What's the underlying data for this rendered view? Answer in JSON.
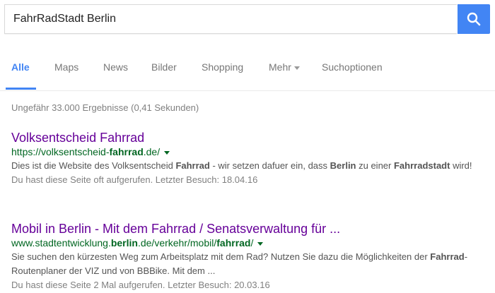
{
  "search": {
    "query": "FahrRadStadt Berlin"
  },
  "tabs": [
    {
      "label": "Alle"
    },
    {
      "label": "Maps"
    },
    {
      "label": "News"
    },
    {
      "label": "Bilder"
    },
    {
      "label": "Shopping"
    },
    {
      "label": "Mehr"
    },
    {
      "label": "Suchoptionen"
    }
  ],
  "stats": "Ungefähr 33.000 Ergebnisse (0,41 Sekunden)",
  "results": [
    {
      "title": "Volksentscheid Fahrrad",
      "url_pre": "https://volksentscheid-",
      "url_bold": "fahrrad",
      "url_post": ".de/",
      "snippet": [
        {
          "t": "Dies ist die Website des Volksentscheid ",
          "b": false
        },
        {
          "t": "Fahrrad",
          "b": true
        },
        {
          "t": " - wir setzen dafuer ein, dass ",
          "b": false
        },
        {
          "t": "Berlin",
          "b": true
        },
        {
          "t": " zu einer ",
          "b": false
        },
        {
          "t": "Fahrradstadt",
          "b": true
        },
        {
          "t": " wird!",
          "b": false
        }
      ],
      "visited": "Du hast diese Seite oft aufgerufen. Letzter Besuch: 18.04.16"
    },
    {
      "title": "Mobil in Berlin - Mit dem Fahrrad / Senatsverwaltung für ...",
      "url_pre": "www.stadtentwicklung.",
      "url_bold": "berlin",
      "url_mid": ".de/verkehr/mobil/",
      "url_bold2": "fahrrad",
      "url_post": "/",
      "snippet": [
        {
          "t": "Sie suchen den kürzesten Weg zum Arbeitsplatz mit dem Rad? Nutzen Sie dazu die Möglichkeiten der ",
          "b": false
        },
        {
          "t": "Fahrrad",
          "b": true
        },
        {
          "t": "-Routenplaner der VIZ und von BBBike. Mit dem ...",
          "b": false
        }
      ],
      "visited": "Du hast diese Seite 2 Mal aufgerufen. Letzter Besuch: 20.03.16"
    }
  ]
}
